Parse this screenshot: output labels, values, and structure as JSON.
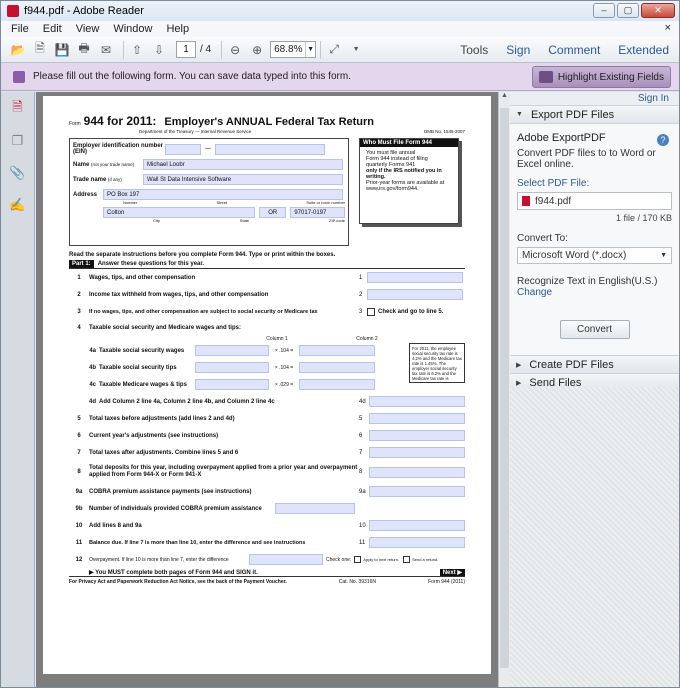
{
  "window": {
    "title": "f944.pdf - Adobe Reader",
    "buttons": [
      "–",
      "▢",
      "✕"
    ]
  },
  "menu": {
    "items": [
      "File",
      "Edit",
      "View",
      "Window",
      "Help"
    ],
    "close": "×"
  },
  "toolbar": {
    "page_current": "1",
    "page_total": "/ 4",
    "zoom": "68.8%",
    "tools": "Tools",
    "sign": "Sign",
    "comment": "Comment",
    "extended": "Extended"
  },
  "formbar": {
    "message": "Please fill out the following form. You can save data typed into this form.",
    "highlight_button": "Highlight Existing Fields"
  },
  "rpanel": {
    "signin": "Sign In",
    "export_title": "Export PDF Files",
    "export_heading": "Adobe ExportPDF",
    "export_desc": "Convert PDF files to to Word or Excel online.",
    "select_label": "Select PDF File:",
    "file_name": "f944.pdf",
    "file_count": "1 file / 170 KB",
    "convert_to_label": "Convert To:",
    "convert_to_value": "Microsoft Word (*.docx)",
    "recognize": "Recognize Text in English(U.S.)",
    "change": "Change",
    "convert_button": "Convert",
    "create_title": "Create PDF Files",
    "send_title": "Send Files"
  },
  "form": {
    "form_label": "Form",
    "title_num": "944 for 2011:",
    "title_text": "Employer's ANNUAL Federal Tax Return",
    "dept": "Department of the Treasury — Internal Revenue Service",
    "omb": "OMB No. 1545-2007",
    "ein_label": "Employer identification number (EIN)",
    "name_label": "Name",
    "name_hint": "(not your trade name)",
    "name_value": "Michael Loobr",
    "trade_label": "Trade name",
    "trade_hint": "(if any)",
    "trade_value": "Wall St Data Intensive Software",
    "address_label": "Address",
    "address_value": "PO Box 197",
    "addr_sub": [
      "Number",
      "Street",
      "Suite or room number"
    ],
    "city_value": "Colton",
    "state_value": "OR",
    "zip_value": "97017-0197",
    "city_sub": [
      "City",
      "State",
      "ZIP code"
    ],
    "who_title": "Who Must File Form 944",
    "who_lines": [
      "You must file annual",
      "Form 944 instead of filing",
      "quarterly Forms 941"
    ],
    "who_bold": "only if the IRS notified you in writing.",
    "who_after": "Prior-year forms are available at www.irs.gov/form944.",
    "read_line": "Read the separate instructions before you complete Form 944. Type or print within the boxes.",
    "part1": "Part 1:",
    "part1_text": "Answer these questions for this year.",
    "lines": [
      {
        "n": "1",
        "t": "Wages, tips, and other compensation",
        "r": "1"
      },
      {
        "n": "2",
        "t": "Income tax withheld from wages, tips, and other compensation",
        "r": "2"
      },
      {
        "n": "3",
        "t": "If no wages, tips, and other compensation are subject to social security or Medicare tax",
        "r": "3",
        "extra": "Check and go to line 5."
      },
      {
        "n": "4",
        "t": "Taxable social security and Medicare wages and tips:"
      }
    ],
    "col1": "Column 1",
    "col2": "Column 2",
    "sublines": [
      {
        "n": "4a",
        "t": "Taxable social security wages",
        "rate": "× .104 ="
      },
      {
        "n": "4b",
        "t": "Taxable social security tips",
        "rate": "× .104 ="
      },
      {
        "n": "4c",
        "t": "Taxable Medicare wages & tips",
        "rate": "× .029 ="
      }
    ],
    "note": "For 2011, the employee social security tax rate is 4.2% and the Medicare tax rate is 1.45%. The employer social security tax rate is 6.2% and the Medicare tax rate is 1.45%.",
    "line4d": {
      "n": "4d",
      "t": "Add Column 2 line 4a, Column 2 line 4b, and Column 2 line 4c",
      "r": "4d"
    },
    "lines2": [
      {
        "n": "5",
        "t": "Total taxes before adjustments (add lines 2 and 4d)",
        "r": "5"
      },
      {
        "n": "6",
        "t": "Current year's adjustments (see instructions)",
        "r": "6"
      },
      {
        "n": "7",
        "t": "Total taxes after adjustments. Combine lines 5 and 6",
        "r": "7"
      },
      {
        "n": "8",
        "t": "Total deposits for this year, including overpayment applied from a prior year and overpayment applied from Form 944-X or Form 941-X",
        "r": "8"
      },
      {
        "n": "9a",
        "t": "COBRA premium assistance payments (see instructions)",
        "r": "9a"
      },
      {
        "n": "9b",
        "t": "Number of individuals provided COBRA premium assistance",
        "r": ""
      },
      {
        "n": "10",
        "t": "Add lines 8 and 9a",
        "r": "10"
      },
      {
        "n": "11",
        "t": "Balance due. If line 7 is more than line 10, enter the difference and see instructions",
        "r": "11"
      }
    ],
    "line12": {
      "n": "12",
      "t": "Overpayment. If line 10 is more than line 7, enter the difference",
      "check": "Check one:",
      "opt1": "Apply to next return.",
      "opt2": "Send a refund."
    },
    "must": "▶ You MUST complete both pages of Form 944 and SIGN it.",
    "next": "Next ▶",
    "footer_left": "For Privacy Act and Paperwork Reduction Act Notice, see the back of the Payment Voucher.",
    "footer_cat": "Cat. No. 39316N",
    "footer_form": "Form 944 (2011)"
  }
}
